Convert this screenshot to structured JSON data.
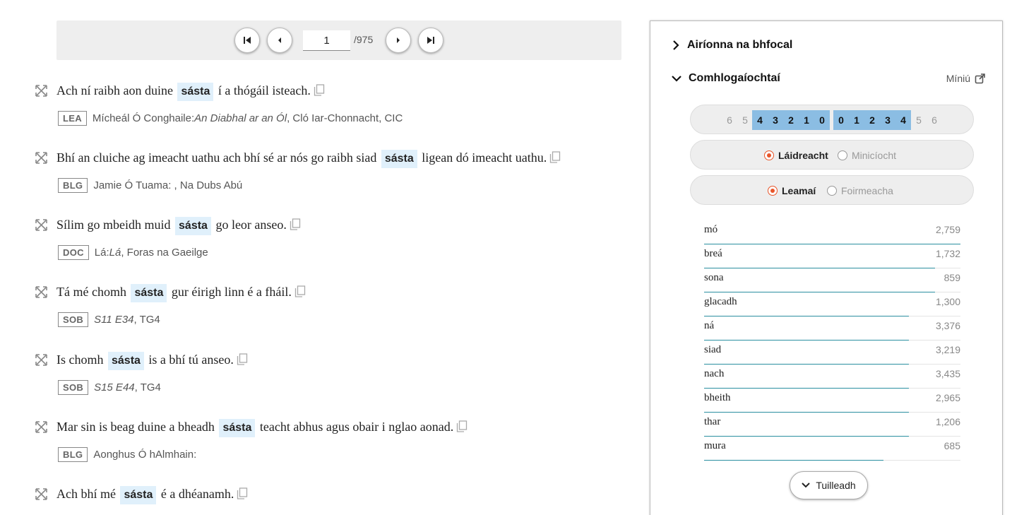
{
  "pager": {
    "current_page": "1",
    "total": "/975"
  },
  "results": [
    {
      "before": "Ach ní raibh aon duine",
      "keyword": "sásta",
      "after": "í a thógáil isteach.",
      "tag": "LEA",
      "source_prefix": "Mícheál Ó Conghaile: ",
      "source_title": "An Diabhal ar an Ól",
      "source_suffix": ", Cló Iar-Chonnacht, CIC"
    },
    {
      "before": "Bhí an cluiche ag imeacht uathu ach bhí sé ar nós go raibh siad",
      "keyword": "sásta",
      "after": "ligean dó imeacht uathu.",
      "tag": "BLG",
      "source_prefix": "Jamie Ó Tuama: , Na Dubs Abú",
      "source_title": "",
      "source_suffix": ""
    },
    {
      "before": "Sílim go mbeidh muid",
      "keyword": "sásta",
      "after": "go leor anseo.",
      "tag": "DOC",
      "source_prefix": "Lá: ",
      "source_title": "Lá",
      "source_suffix": ", Foras na Gaeilge"
    },
    {
      "before": "Tá mé chomh",
      "keyword": "sásta",
      "after": "gur éirigh linn é a fháil.",
      "tag": "SOB",
      "source_prefix": "",
      "source_title": "S11 E34",
      "source_suffix": ", TG4"
    },
    {
      "before": "Is chomh",
      "keyword": "sásta",
      "after": "is a bhí tú anseo.",
      "tag": "SOB",
      "source_prefix": "",
      "source_title": "S15 E44",
      "source_suffix": ", TG4"
    },
    {
      "before": "Mar sin is beag duine a bheadh",
      "keyword": "sásta",
      "after": "teacht abhus agus obair i nglao aonad.",
      "tag": "BLG",
      "source_prefix": "Aonghus Ó hAlmhain:",
      "source_title": "",
      "source_suffix": ""
    },
    {
      "before": "Ach bhí mé",
      "keyword": "sásta",
      "after": "é a dhéanamh.",
      "tag": "",
      "source_prefix": "",
      "source_title": "",
      "source_suffix": ""
    }
  ],
  "sidebar": {
    "section1_title": "Airíonna na bhfocal",
    "section2_title": "Comhlogaíochtaí",
    "miniu_label": "Míniú",
    "window_left": [
      "6",
      "5",
      "4",
      "3",
      "2",
      "1",
      "0"
    ],
    "window_right": [
      "0",
      "1",
      "2",
      "3",
      "4",
      "5",
      "6"
    ],
    "toggle1": {
      "on": "Láidreacht",
      "off": "Minicíocht"
    },
    "toggle2": {
      "on": "Leamaí",
      "off": "Foirmeacha"
    },
    "collocations": [
      {
        "word": "mó",
        "count": "2,759",
        "strength": 1.0
      },
      {
        "word": "breá",
        "count": "1,732",
        "strength": 0.9
      },
      {
        "word": "sona",
        "count": "859",
        "strength": 0.9
      },
      {
        "word": "glacadh",
        "count": "1,300",
        "strength": 0.8
      },
      {
        "word": "ná",
        "count": "3,376",
        "strength": 0.8
      },
      {
        "word": "siad",
        "count": "3,219",
        "strength": 0.8
      },
      {
        "word": "nach",
        "count": "3,435",
        "strength": 0.8
      },
      {
        "word": "bheith",
        "count": "2,965",
        "strength": 0.8
      },
      {
        "word": "thar",
        "count": "1,206",
        "strength": 0.8
      },
      {
        "word": "mura",
        "count": "685",
        "strength": 0.7
      }
    ],
    "more_label": "Tuilleadh"
  },
  "colors": {
    "accent_radio": "#e8552a",
    "highlight": "#e0f0fb",
    "window_selected": "#8bbde3",
    "bar": "#2a8fa0"
  }
}
